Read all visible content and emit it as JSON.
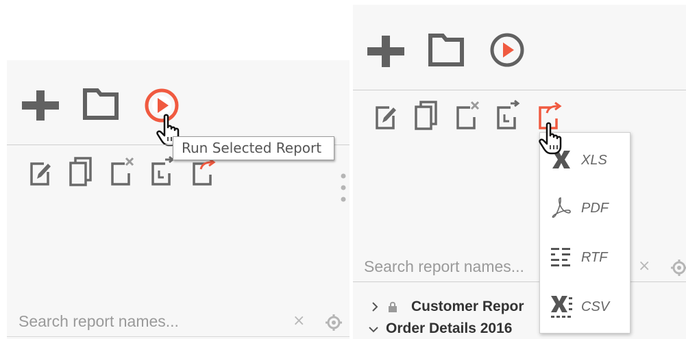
{
  "colors": {
    "accent": "#f05a40",
    "icon_gray": "#6a6a6a",
    "panel_bg": "#f7f7f7"
  },
  "left_panel": {
    "toolbar_icons": [
      "add-icon",
      "folder-icon",
      "run-icon"
    ],
    "action_icons": [
      "edit-icon",
      "copy-icon",
      "delete-icon",
      "schedule-icon",
      "export-icon"
    ],
    "tooltip": "Run Selected Report",
    "search": {
      "placeholder": "Search report names...",
      "clear": "×"
    }
  },
  "right_panel": {
    "toolbar_icons": [
      "add-icon",
      "folder-icon",
      "run-icon"
    ],
    "action_icons": [
      "edit-icon",
      "copy-icon",
      "delete-icon",
      "schedule-icon",
      "export-icon"
    ],
    "search": {
      "placeholder": "Search report names...",
      "clear": "×"
    },
    "export_menu": [
      {
        "icon": "xls-icon",
        "label": "XLS"
      },
      {
        "icon": "pdf-icon",
        "label": "PDF"
      },
      {
        "icon": "rtf-icon",
        "label": "RTF"
      },
      {
        "icon": "csv-icon",
        "label": "CSV"
      }
    ],
    "tree": [
      {
        "label": "Customer Repor",
        "expanded": false,
        "locked": true
      },
      {
        "label": "Order Details 2016",
        "expanded": true,
        "locked": false
      }
    ]
  }
}
